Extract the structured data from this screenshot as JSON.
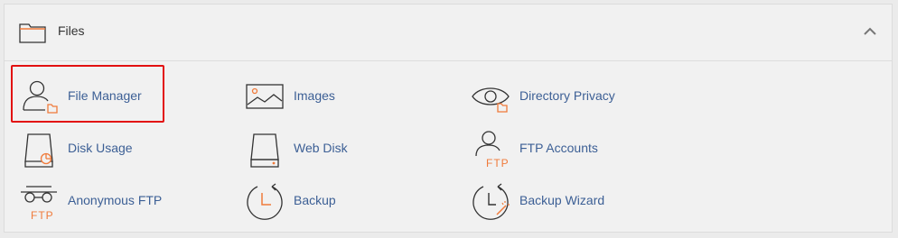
{
  "section": {
    "title": "Files",
    "header_icon": "folder-icon",
    "collapse_icon": "chevron-up-icon"
  },
  "items": [
    {
      "label": "File Manager",
      "icon": "file-manager-icon"
    },
    {
      "label": "Images",
      "icon": "images-icon"
    },
    {
      "label": "Directory Privacy",
      "icon": "directory-privacy-icon"
    },
    {
      "label": "Disk Usage",
      "icon": "disk-usage-icon"
    },
    {
      "label": "Web Disk",
      "icon": "web-disk-icon"
    },
    {
      "label": "FTP Accounts",
      "icon": "ftp-accounts-icon"
    },
    {
      "label": "Anonymous FTP",
      "icon": "anonymous-ftp-icon"
    },
    {
      "label": "Backup",
      "icon": "backup-icon"
    },
    {
      "label": "Backup Wizard",
      "icon": "backup-wizard-icon"
    }
  ],
  "colors": {
    "link": "#3c5f95",
    "accent": "#f07a3a",
    "highlight": "#e21010",
    "icon_stroke": "#333333"
  }
}
